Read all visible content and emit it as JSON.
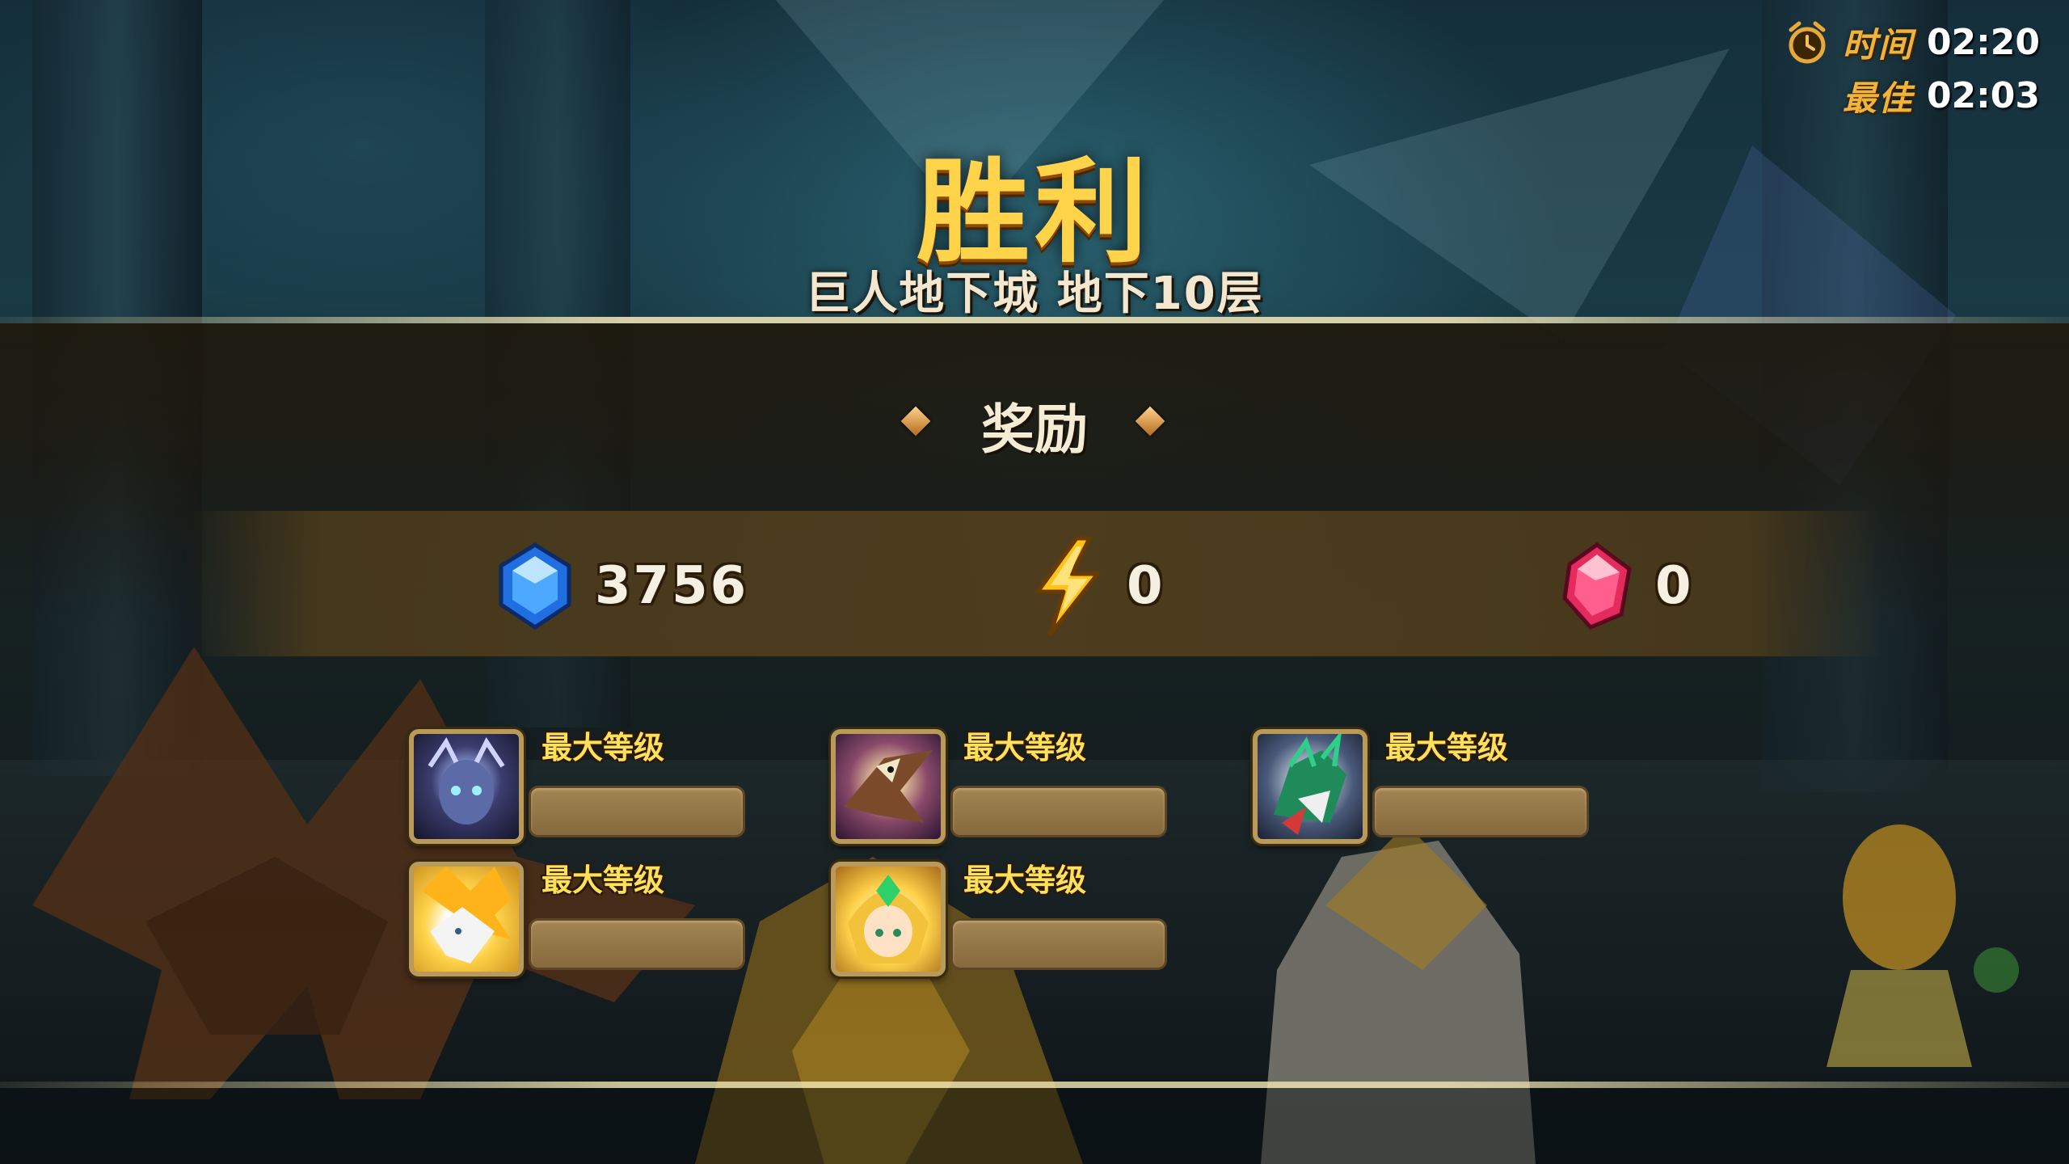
{
  "timer": {
    "time_label": "时间",
    "time_value": "02:20",
    "best_label": "最佳",
    "best_value": "02:03",
    "icon": "alarm-clock-icon"
  },
  "result": {
    "title": "胜利",
    "subtitle": "巨人地下城 地下10层"
  },
  "rewards": {
    "title": "奖励",
    "items": [
      {
        "icon": "blue-crystal-icon",
        "value": "3756",
        "color": "#2f8cff"
      },
      {
        "icon": "lightning-energy-icon",
        "value": "0",
        "color": "#ffc21a"
      },
      {
        "icon": "pink-crystal-icon",
        "value": "0",
        "color": "#ff3e73"
      }
    ]
  },
  "heroes": [
    {
      "label": "最大等级",
      "portrait": "dark-demon-portrait"
    },
    {
      "label": "最大等级",
      "portrait": "eagle-warrior-portrait"
    },
    {
      "label": "最大等级",
      "portrait": "green-dragon-portrait"
    },
    {
      "label": "最大等级",
      "portrait": "golden-wolf-portrait"
    },
    {
      "label": "最大等级",
      "portrait": "fairy-girl-portrait"
    }
  ],
  "colors": {
    "gold_text": "#ffd34a",
    "label_orange": "#f2b33a",
    "exp_bar": "#a28552"
  }
}
